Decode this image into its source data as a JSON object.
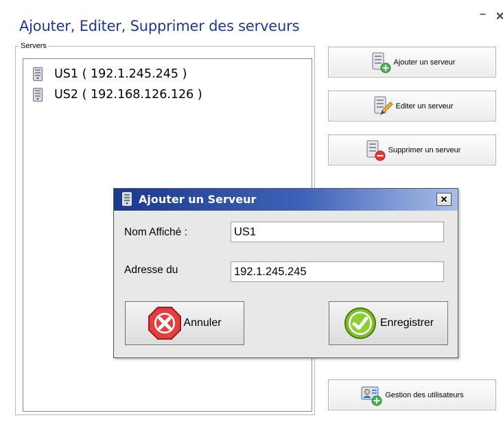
{
  "window": {
    "title": "Ajouter, Editer, Supprimer des serveurs",
    "minimize_glyph": "–",
    "close_glyph": "✕"
  },
  "servers_group": {
    "legend": "Servers",
    "items": [
      {
        "label": "US1 ( 192.1.245.245 )",
        "icon": "server-icon"
      },
      {
        "label": "US2 ( 192.168.126.126 )",
        "icon": "server-icon"
      }
    ]
  },
  "actions": {
    "add_label": "Ajouter un serveur",
    "edit_label": "Editer un serveur",
    "delete_label": "Supprimer un serveur",
    "users_label": "Gestion des utilisateurs"
  },
  "dialog": {
    "title": "Ajouter un Serveur",
    "close_glyph": "✕",
    "name_label": "Nom Affiché :",
    "name_value": "US1",
    "address_label": "Adresse du",
    "address_value": "192.1.245.245",
    "cancel_label": "Annuler",
    "save_label": "Enregistrer"
  },
  "colors": {
    "title": "#1e3a8a",
    "titlebar_start": "#1b3a8c",
    "titlebar_end": "#a9bfe8",
    "cancel_red": "#e04040",
    "save_green": "#7cbf2a"
  }
}
